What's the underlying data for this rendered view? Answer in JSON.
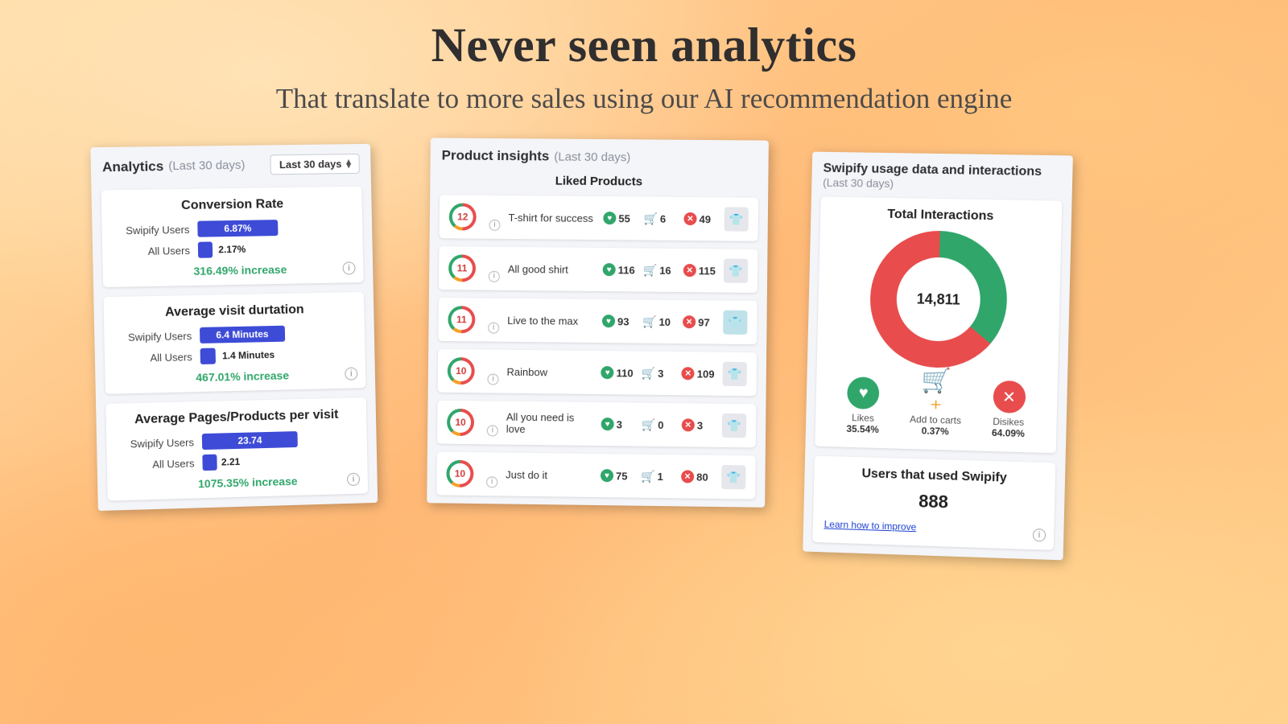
{
  "hero": {
    "title": "Never seen analytics",
    "subtitle": "That translate to more sales using our AI recommendation engine"
  },
  "analytics": {
    "title": "Analytics",
    "period": "(Last 30 days)",
    "select": "Last 30 days",
    "row_labels": {
      "swipify": "Swipify Users",
      "all": "All Users"
    },
    "cards": [
      {
        "title": "Conversion Rate",
        "swipify_val": "6.87%",
        "swipify_pct": 52,
        "all_val": "2.17%",
        "all_pct": 9,
        "increase": "316.49% increase"
      },
      {
        "title": "Average visit durtation",
        "swipify_val": "6.4 Minutes",
        "swipify_pct": 55,
        "all_val": "1.4 Minutes",
        "all_pct": 10,
        "increase": "467.01% increase"
      },
      {
        "title": "Average Pages/Products per visit",
        "swipify_val": "23.74",
        "swipify_pct": 62,
        "all_val": "2.21",
        "all_pct": 8,
        "increase": "1075.35% increase"
      }
    ]
  },
  "insights": {
    "title": "Product insights",
    "period": "(Last 30 days)",
    "subtitle": "Liked Products",
    "products": [
      {
        "rank": "12",
        "name": "T-shirt for success",
        "likes": "55",
        "carts": "6",
        "dislikes": "49",
        "thumb": "plain"
      },
      {
        "rank": "11",
        "name": "All good shirt",
        "likes": "116",
        "carts": "16",
        "dislikes": "115",
        "thumb": "plain"
      },
      {
        "rank": "11",
        "name": "Live to the max",
        "likes": "93",
        "carts": "10",
        "dislikes": "97",
        "thumb": "cyan"
      },
      {
        "rank": "10",
        "name": "Rainbow",
        "likes": "110",
        "carts": "3",
        "dislikes": "109",
        "thumb": "plain"
      },
      {
        "rank": "10",
        "name": "All you need is love",
        "likes": "3",
        "carts": "0",
        "dislikes": "3",
        "thumb": "plain"
      },
      {
        "rank": "10",
        "name": "Just do it",
        "likes": "75",
        "carts": "1",
        "dislikes": "80",
        "thumb": "plain"
      }
    ]
  },
  "usage": {
    "title": "Swipify usage data and interactions",
    "period": "(Last 30 days)",
    "total_title": "Total Interactions",
    "total": "14,811",
    "likes": {
      "label": "Likes",
      "pct": "35.54%"
    },
    "carts": {
      "label": "Add to carts",
      "pct": "0.37%"
    },
    "dislikes": {
      "label": "Disikes",
      "pct": "64.09%"
    },
    "users_title": "Users that used Swipify",
    "users": "888",
    "learn": "Learn how to improve"
  },
  "chart_data": {
    "type": "pie",
    "title": "Total Interactions",
    "total": 14811,
    "series": [
      {
        "name": "Likes",
        "pct": 35.54,
        "color": "#30a66a"
      },
      {
        "name": "Add to carts",
        "pct": 0.37,
        "color": "#f4a027"
      },
      {
        "name": "Dislikes",
        "pct": 64.09,
        "color": "#e84c4c"
      }
    ]
  }
}
